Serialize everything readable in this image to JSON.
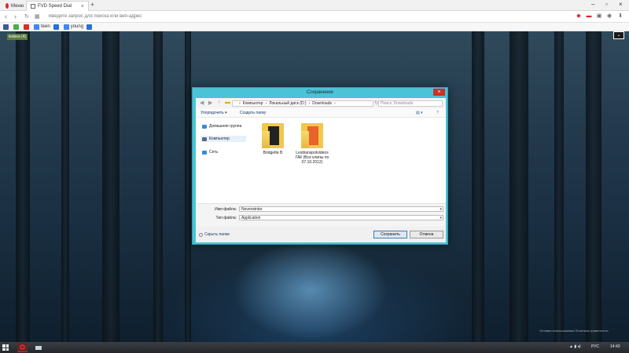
{
  "browser": {
    "tabs": [
      {
        "label": "Меню"
      },
      {
        "label": "FVD Speed Dial"
      }
    ],
    "address_placeholder": "Введите запрос для поиска или веб-адрес",
    "bookmarks": [
      {
        "label": "",
        "color": "#3b5998"
      },
      {
        "label": "",
        "color": "#4cae4c"
      },
      {
        "label": "",
        "color": "#d93025"
      },
      {
        "label": "teen",
        "color": "#4285f4"
      },
      {
        "label": "",
        "color": "#2a6fd8"
      },
      {
        "label": "young",
        "color": "#4285f4"
      },
      {
        "label": "",
        "color": "#2a6fd8"
      }
    ],
    "speed_dial_badge": "lesbea (4)"
  },
  "dialog": {
    "title": "Сохранение",
    "breadcrumbs": [
      "Компьютер",
      "Локальный диск (D:)",
      "Downloads"
    ],
    "search_placeholder": "Поиск: Downloads",
    "toolbar": {
      "organize": "Упорядочить ▾",
      "new_folder": "Создать папку"
    },
    "nav": [
      {
        "label": "Домашняя группа",
        "icon": "homegroup-icon",
        "color": "#3a8ad6"
      },
      {
        "label": "Компьютер",
        "icon": "computer-icon",
        "color": "#5a6a7a"
      },
      {
        "label": "Сеть",
        "icon": "network-icon",
        "color": "#3a8ad6"
      }
    ],
    "folders": [
      {
        "label": "Bridgette B",
        "paper_color": "#222222"
      },
      {
        "label": "Lesbianspotvideos ГАК (Все клипы по 07.10.2012)",
        "paper_color": "#e8622a"
      }
    ],
    "filename_label": "Имя файла:",
    "filename_value": "Neverwinter",
    "filetype_label": "Тип файла:",
    "filetype_value": "Application",
    "hide_folders": "Скрыть папки",
    "save_label": "Сохранить",
    "cancel_label": "Отмена"
  },
  "taskbar": {
    "language": "РУС",
    "time": "14:43"
  },
  "watermark": "Условия использования   Политика приватности"
}
